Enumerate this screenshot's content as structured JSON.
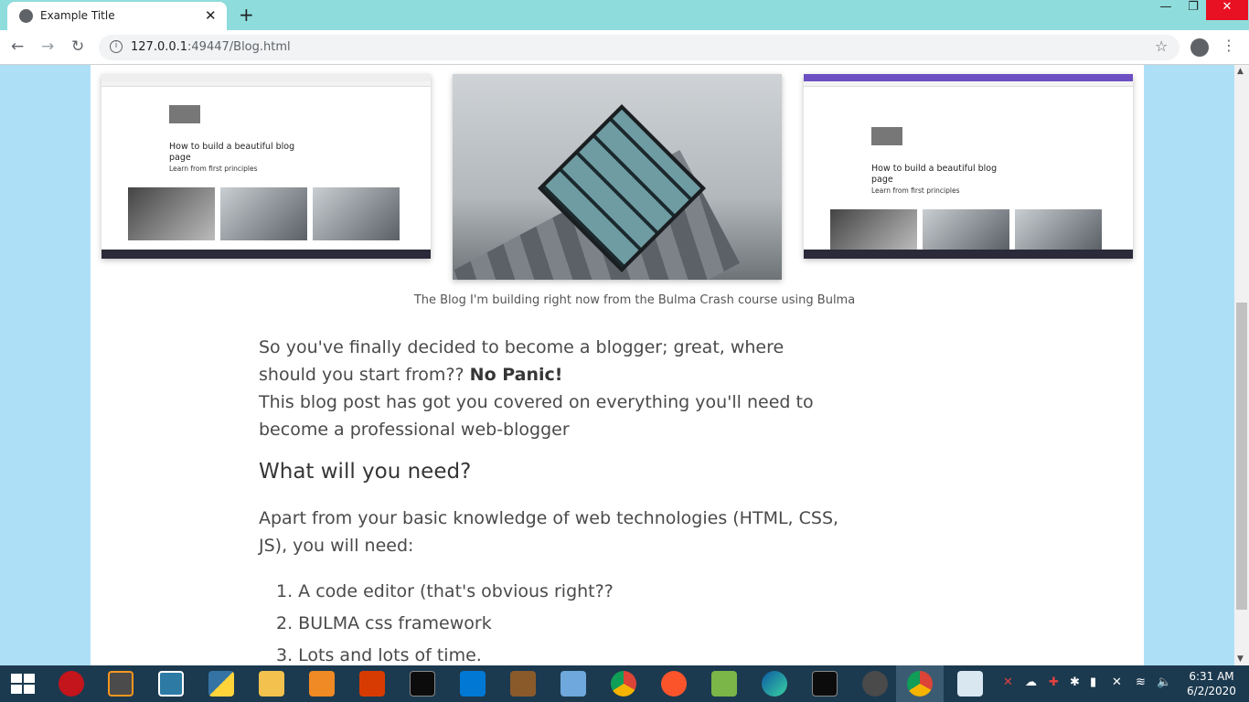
{
  "browser": {
    "tab_title": "Example Title",
    "tab_close": "✕",
    "new_tab": "+",
    "url_host": "127.0.0.1",
    "url_rest": ":49447/Blog.html",
    "minimize": "—",
    "restore": "❐",
    "close": "✕"
  },
  "figures": {
    "left_shot": {
      "title": "How to build a beautiful blog page",
      "subtitle": "Learn from first principles"
    },
    "right_shot": {
      "title": "How to build a beautiful blog page",
      "subtitle": "Learn from first principles"
    },
    "caption": "The Blog I'm building right now from the Bulma Crash course using Bulma"
  },
  "article": {
    "intro_1": "So you've finally decided to become a blogger; great, where should you start from??",
    "intro_bold": "No Panic!",
    "intro_2": "This blog post has got you covered on everything you'll need to become a professional web-blogger",
    "heading": "What will you need?",
    "needs_intro": "Apart from your basic knowledge of web technologies (HTML, CSS, JS), you will need:",
    "list": [
      "1. A code editor (that's obvious right??",
      "2. BULMA css framework",
      "3. Lots and lots of time."
    ]
  },
  "taskbar": {
    "time": "6:31 AM",
    "date": "6/2/2020",
    "apps": [
      "opera-icon",
      "sublime-icon",
      "bracket-app-icon",
      "python-icon",
      "file-explorer-icon",
      "media-player-icon",
      "office-icon",
      "terminal-icon",
      "vscode-icon",
      "game-icon",
      "sniffer-icon",
      "chrome-icon",
      "brave-icon",
      "pinball-icon",
      "edge-icon",
      "terminal2-icon",
      "python2-icon",
      "chrome-active-icon",
      "paint-icon"
    ],
    "colors": {
      "taskbar": "#1c3a4f",
      "page_bg": "#ade0f7",
      "tabbar": "#8fdcdc"
    }
  }
}
